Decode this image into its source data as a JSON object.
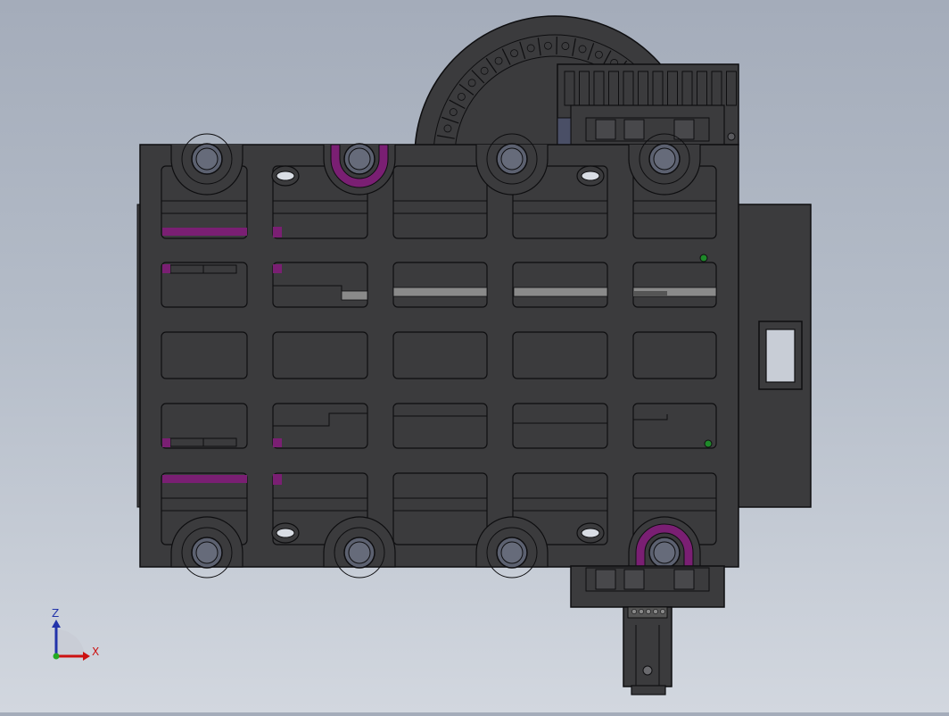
{
  "colors": {
    "body": "#3b3b3d",
    "edge": "#0e0e10",
    "highlight": "#7a1f73",
    "bore": "#5c6170",
    "bar": "#8a8a8a",
    "sensor": "#1f8a2a",
    "axis_z": "#2233aa",
    "axis_x": "#cc1111",
    "axis_y": "#22aa22"
  },
  "triad": {
    "z_label": "Z",
    "x_label": "X"
  },
  "icons": [
    "coordinate-triad-icon",
    "drag-chain-icon"
  ]
}
